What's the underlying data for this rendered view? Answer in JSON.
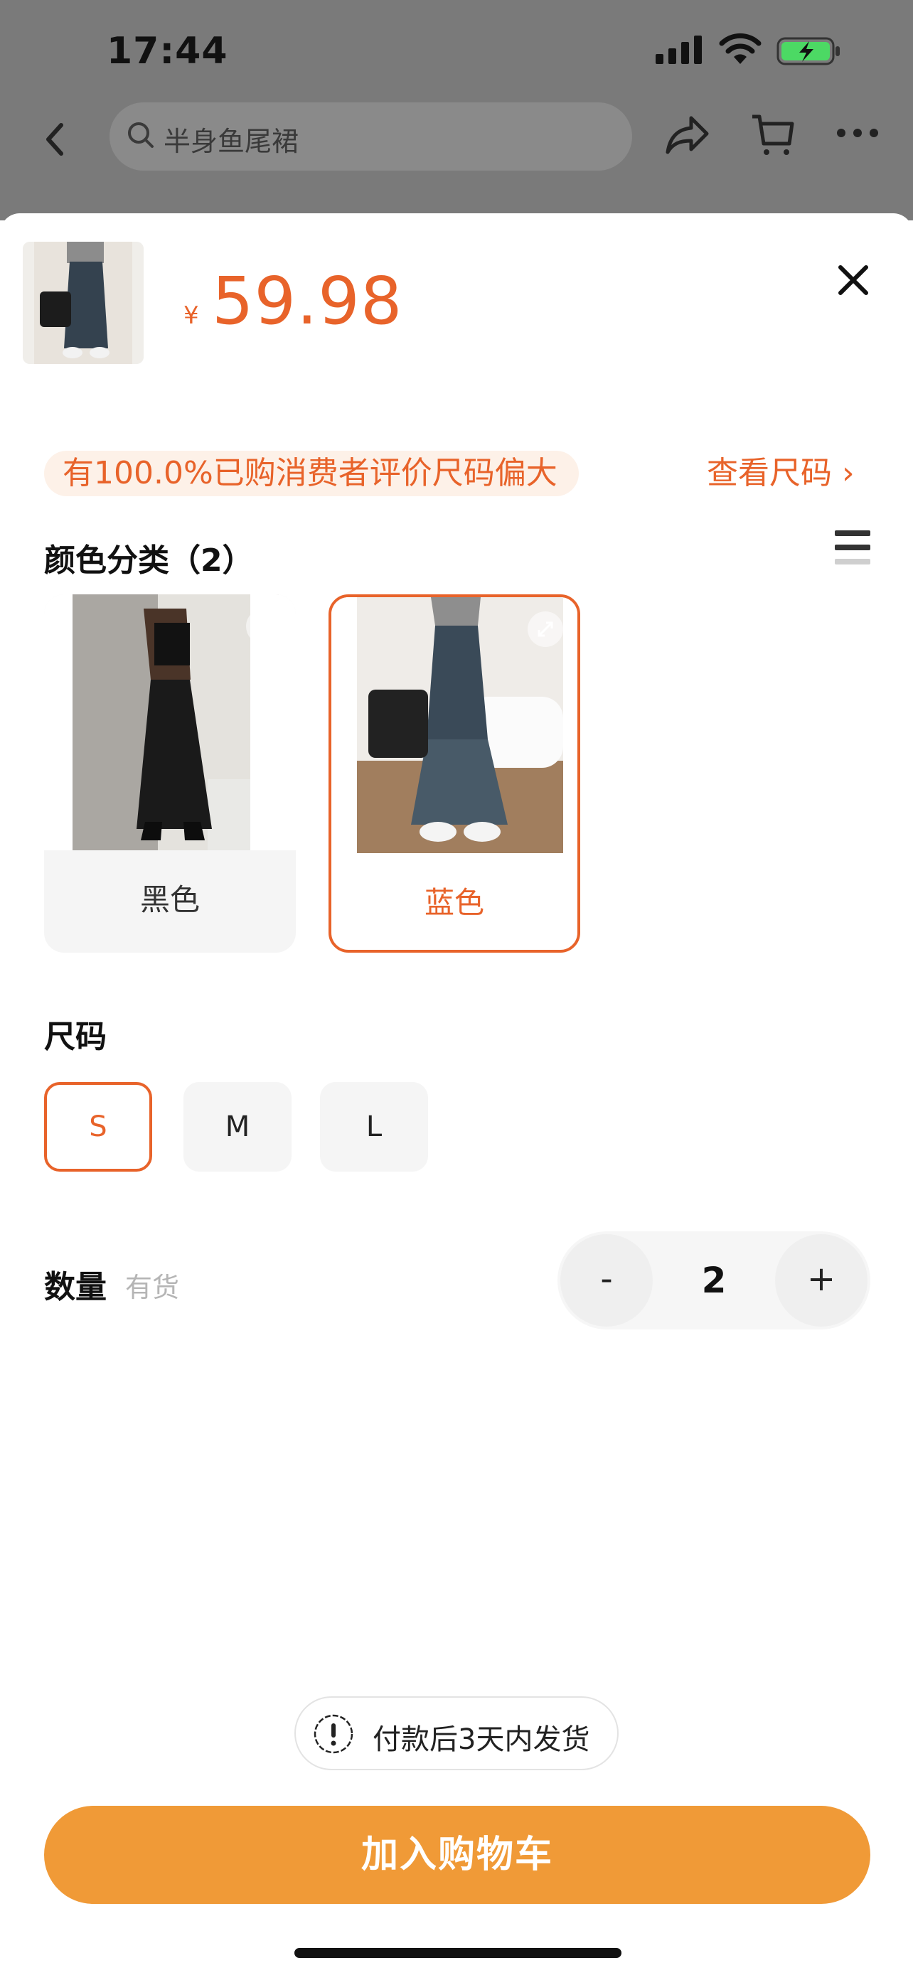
{
  "status_bar": {
    "time": "17:44"
  },
  "background_page": {
    "search_placeholder": "半身鱼尾裙"
  },
  "sheet": {
    "price_symbol": "¥",
    "price": "59.98",
    "size_hint": "有100.0%已购消费者评价尺码偏大",
    "size_link": "查看尺码 ›",
    "color_section_title": "颜色分类（2）",
    "colors": [
      {
        "label": "黑色",
        "selected": false
      },
      {
        "label": "蓝色",
        "selected": true
      }
    ],
    "size_section_title": "尺码",
    "sizes": [
      {
        "label": "S",
        "selected": true
      },
      {
        "label": "M",
        "selected": false
      },
      {
        "label": "L",
        "selected": false
      }
    ],
    "quantity_label": "数量",
    "stock_status": "有货",
    "quantity": {
      "minus": "-",
      "value": "2",
      "plus": "+"
    },
    "shipping_notice": "付款后3天内发货",
    "add_to_cart": "加入购物车"
  },
  "colors": {
    "accent": "#e8632a",
    "cta": "#f09a37"
  }
}
